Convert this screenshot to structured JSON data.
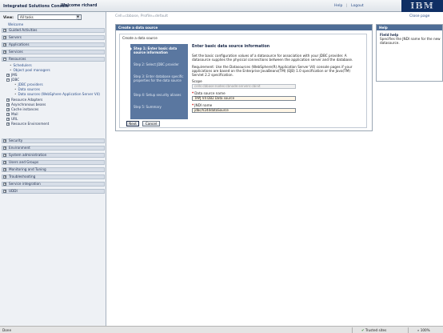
{
  "header": {
    "brand": "Integrated Solutions Console",
    "welcome": "Welcome richard",
    "help_link": "Help",
    "separator": "|",
    "logout_link": "Logout",
    "logo": "IBM"
  },
  "nav": {
    "view_label": "View:",
    "view_value": "All tasks",
    "welcome_link": "Welcome",
    "sections": {
      "guided": "Guided Activities",
      "servers": "Servers",
      "applications": "Applications",
      "services": "Services",
      "resources": "Resources",
      "security": "Security",
      "environment": "Environment",
      "sysadmin": "System administration",
      "users": "Users and Groups",
      "monitoring": "Monitoring and Tuning",
      "troubleshooting": "Troubleshooting",
      "service_integration": "Service integration",
      "uddi": "UDDI"
    },
    "resources_items": {
      "schedulers": "Schedulers",
      "object_pool": "Object pool managers",
      "jms": "JMS",
      "jdbc": "JDBC",
      "jdbc_providers": "JDBC providers",
      "data_sources": "Data sources",
      "data_sources_v4": "Data sources (WebSphere Application Server V4)",
      "resource_adapters": "Resource Adapters",
      "async_beans": "Asynchronous beans",
      "cache_instances": "Cache instances",
      "mail": "Mail",
      "url": "URL",
      "resource_env": "Resource Environment"
    }
  },
  "main": {
    "breadcrumb": "Cell=cbbase, Profile=default",
    "close_page": "Close page",
    "panel_title": "Create a data source",
    "create_title": "Create a data source",
    "steps": [
      "Step 1: Enter basic data source information",
      "Step 2: Select JDBC provider",
      "Step 3: Enter database specific properties for the data source",
      "Step 4: Setup security aliases",
      "Step 5: Summary"
    ],
    "form": {
      "title": "Enter basic data source information",
      "para1": "Set the basic configuration values of a datasource for association with your JDBC provider. A datasource supplies the physical connections between the application server and the database.",
      "para2": "Requirement: Use the Datasources (WebSphere(R) Application Server V4) console pages if your applications are based on the Enterprise JavaBeans(TM) (EJB) 1.0 specification or the Java(TM) Servlet 2.2 specification.",
      "scope_label": "Scope",
      "scope_value": "cells:cbbase:nodes:cbnode:servers:cbinit",
      "ds_name_label": "Data source name",
      "ds_name_value": "TAPJ V4 DB2 Data source",
      "jndi_label": "JNDI name",
      "jndi_value": "jdbc/V240dataSource",
      "required_marker": "*"
    },
    "buttons": {
      "next": "Next",
      "cancel": "Cancel"
    }
  },
  "help": {
    "title": "Help",
    "field_help_title": "Field help",
    "field_help_text": "Specifies the JNDI name for the new datasource."
  },
  "statusbar": {
    "status": "Done",
    "zone": "Trusted sites",
    "zoom": "100%"
  }
}
